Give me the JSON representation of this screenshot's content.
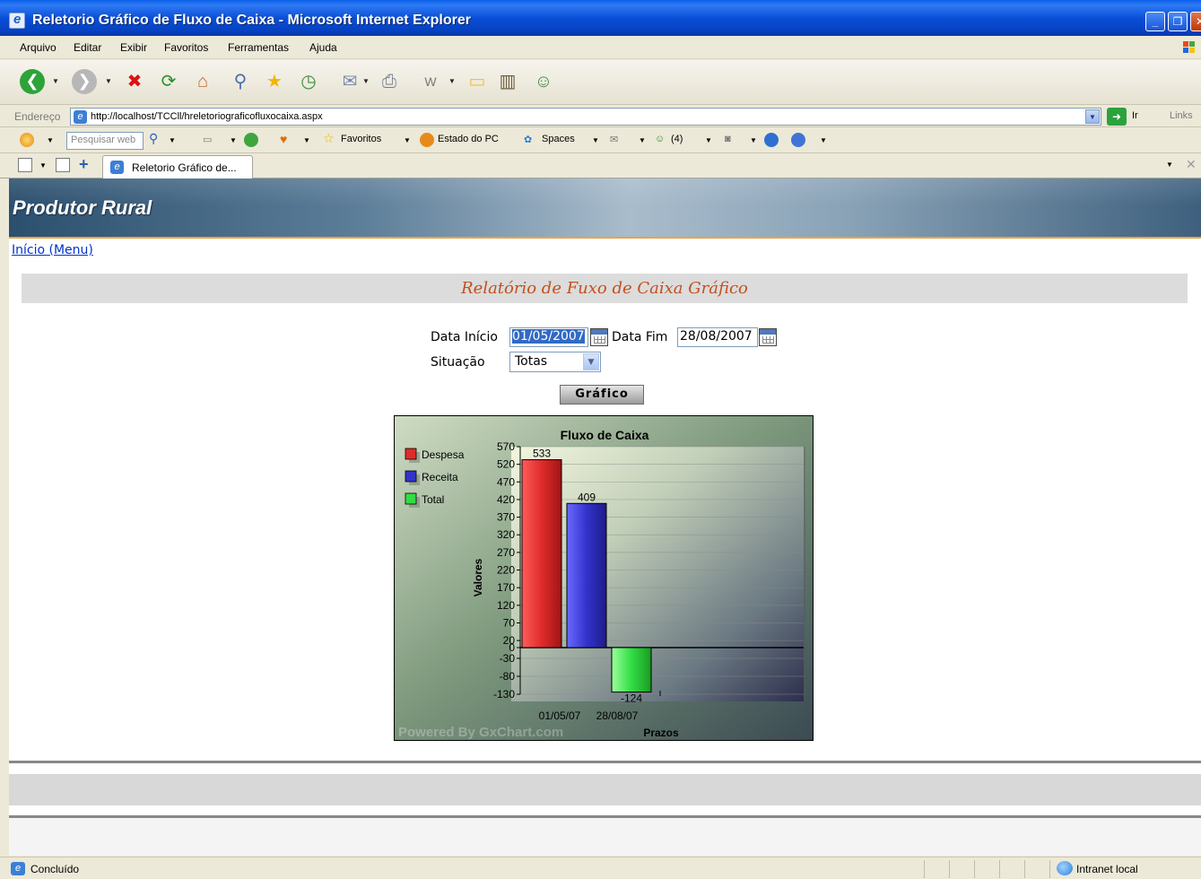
{
  "window": {
    "title": "Reletorio Gráfico de Fluxo de Caixa - Microsoft Internet Explorer"
  },
  "menubar": {
    "items": [
      "Arquivo",
      "Editar",
      "Exibir",
      "Favoritos",
      "Ferramentas",
      "Ajuda"
    ]
  },
  "address": {
    "label": "Endereço",
    "url": "http://localhost/TCCll/hreletoriograficofluxocaixa.aspx",
    "go_label": "Ir",
    "links_label": "Links"
  },
  "searchbar": {
    "search_placeholder": "Pesquisar web",
    "favoritos": "Favoritos",
    "estado_pc": "Estado do PC",
    "spaces": "Spaces",
    "contacts_count": "(4)"
  },
  "tab": {
    "title": "Reletorio Gráfico de..."
  },
  "page": {
    "site_title": "Produtor Rural",
    "menu_link": "Início (Menu)",
    "report_title": "Relatório de Fuxo de Caixa Gráfico",
    "data_inicio_label": "Data Início",
    "data_inicio_value": "01/05/2007",
    "data_fim_label": "Data Fim",
    "data_fim_value": "28/08/2007",
    "situacao_label": "Situação",
    "situacao_value": "Totas",
    "grafico_button": "Gráfico"
  },
  "chart_data": {
    "type": "bar",
    "title": "Fluxo de Caixa",
    "ylabel": "Valores",
    "xlabel": "Prazos",
    "watermark": "Powered By GxChart.com",
    "x_tick_labels": [
      "01/05/07",
      "28/08/07"
    ],
    "y_ticks": [
      570,
      520,
      470,
      420,
      370,
      320,
      270,
      220,
      170,
      120,
      70,
      20,
      0,
      -30,
      -80,
      -130
    ],
    "ylim": [
      -130,
      570
    ],
    "legend_position": "top-left",
    "series": [
      {
        "name": "Despesa",
        "value": 533,
        "color": "#e02b2b"
      },
      {
        "name": "Receita",
        "value": 409,
        "color": "#3333cc"
      },
      {
        "name": "Total",
        "value": -124,
        "color": "#33dd44"
      }
    ]
  },
  "status": {
    "text": "Concluído",
    "zone": "Intranet local"
  }
}
